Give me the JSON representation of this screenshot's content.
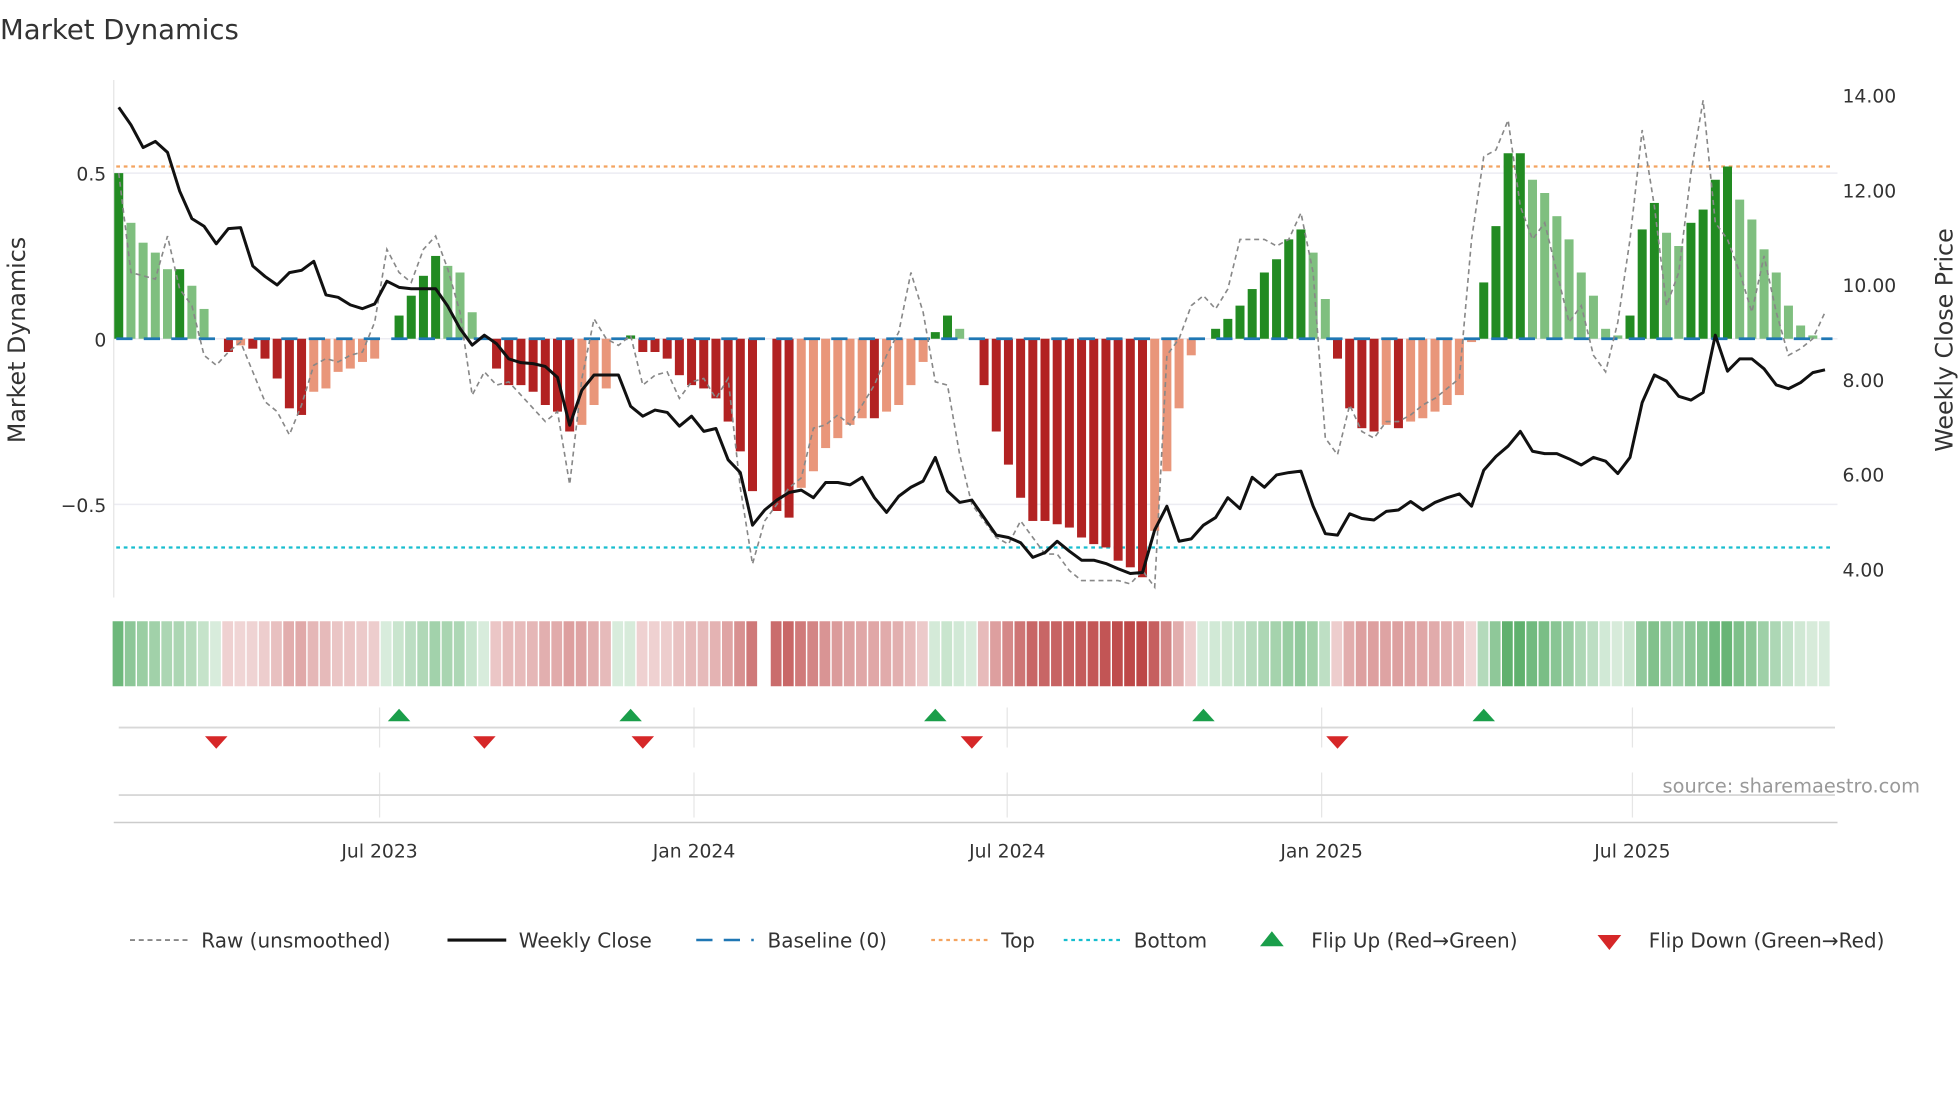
{
  "title": "Market Dynamics",
  "source": "source: sharemaestro.com",
  "legend": {
    "raw": "Raw (unsmoothed)",
    "close": "Weekly Close",
    "baseline": "Baseline (0)",
    "top": "Top",
    "bottom": "Bottom",
    "flip_up": "Flip Up (Red→Green)",
    "flip_down": "Flip Down (Green→Red)"
  },
  "colors": {
    "pos_strong": "#228b22",
    "pos_weak": "#7fbf7f",
    "neg_strong": "#b22222",
    "neg_weak": "#e9967a",
    "baseline": "#1f77b4",
    "top": "#f4a460",
    "bottom": "#17becf",
    "flip_up": "#1a9e4a",
    "flip_down": "#d62728",
    "close": "#111111",
    "raw": "#888888"
  },
  "chart_data": {
    "type": "bar",
    "title": "Market Dynamics",
    "ylabel": "Market Dynamics",
    "y2label": "Weekly Close Price",
    "ylim": [
      -0.78,
      0.78
    ],
    "y2lim": [
      3.0,
      14.5
    ],
    "yticks": [
      {
        "v": 0.5,
        "label": "0.5"
      },
      {
        "v": 0,
        "label": "0"
      },
      {
        "v": -0.5,
        "label": "−0.5"
      }
    ],
    "y2ticks": [
      {
        "v": 14,
        "label": "14.00"
      },
      {
        "v": 12,
        "label": "12.00"
      },
      {
        "v": 10,
        "label": "10.00"
      },
      {
        "v": 8,
        "label": "8.00"
      },
      {
        "v": 6,
        "label": "6.00"
      },
      {
        "v": 4,
        "label": "4.00"
      }
    ],
    "xticks": [
      {
        "week": 21.4,
        "label": "Jul 2023"
      },
      {
        "week": 47.2,
        "label": "Jan 2024"
      },
      {
        "week": 72.9,
        "label": "Jul 2024"
      },
      {
        "week": 98.7,
        "label": "Jan 2025"
      },
      {
        "week": 124.2,
        "label": "Jul 2025"
      }
    ],
    "top_level": 0.52,
    "bottom_level": -0.63,
    "momentum": [
      0.5,
      0.35,
      0.29,
      0.26,
      0.21,
      0.21,
      0.16,
      0.09,
      0,
      -0.04,
      -0.02,
      -0.03,
      -0.06,
      -0.12,
      -0.21,
      -0.23,
      -0.16,
      -0.15,
      -0.1,
      -0.09,
      -0.07,
      -0.06,
      0,
      0.07,
      0.13,
      0.19,
      0.25,
      0.22,
      0.2,
      0.08,
      0,
      -0.09,
      -0.14,
      -0.14,
      -0.16,
      -0.2,
      -0.22,
      -0.28,
      -0.26,
      -0.2,
      -0.15,
      0,
      0.01,
      -0.04,
      -0.04,
      -0.06,
      -0.11,
      -0.14,
      -0.15,
      -0.18,
      -0.25,
      -0.34,
      -0.46,
      0,
      -0.52,
      -0.54,
      -0.45,
      -0.4,
      -0.33,
      -0.3,
      -0.26,
      -0.24,
      -0.24,
      -0.22,
      -0.2,
      -0.14,
      -0.07,
      0.02,
      0.07,
      0.03,
      0,
      -0.14,
      -0.28,
      -0.38,
      -0.48,
      -0.55,
      -0.55,
      -0.56,
      -0.57,
      -0.6,
      -0.62,
      -0.63,
      -0.67,
      -0.69,
      -0.72,
      -0.58,
      -0.4,
      -0.21,
      -0.05,
      0,
      0.03,
      0.06,
      0.1,
      0.15,
      0.2,
      0.24,
      0.3,
      0.33,
      0.26,
      0.12,
      -0.06,
      -0.21,
      -0.27,
      -0.28,
      -0.26,
      -0.27,
      -0.25,
      -0.24,
      -0.22,
      -0.2,
      -0.17,
      -0.01,
      0.17,
      0.34,
      0.56,
      0.56,
      0.48,
      0.44,
      0.37,
      0.3,
      0.2,
      0.13,
      0.03,
      0.01,
      0.07,
      0.33,
      0.41,
      0.32,
      0.28,
      0.35,
      0.39,
      0.48,
      0.52,
      0.42,
      0.36,
      0.27,
      0.2,
      0.1,
      0.04,
      0.01,
      0.0
    ],
    "raw": [
      0.5,
      0.2,
      0.19,
      0.18,
      0.31,
      0.15,
      0.1,
      -0.05,
      -0.08,
      -0.04,
      -0.01,
      -0.1,
      -0.19,
      -0.22,
      -0.29,
      -0.2,
      -0.08,
      -0.06,
      -0.07,
      -0.05,
      -0.04,
      0.05,
      0.27,
      0.2,
      0.17,
      0.27,
      0.31,
      0.21,
      0.08,
      -0.17,
      -0.1,
      -0.14,
      -0.13,
      -0.17,
      -0.21,
      -0.25,
      -0.22,
      -0.44,
      -0.12,
      0.06,
      0.0,
      -0.02,
      0.01,
      -0.14,
      -0.11,
      -0.1,
      -0.18,
      -0.13,
      -0.12,
      -0.18,
      -0.12,
      -0.45,
      -0.68,
      -0.55,
      -0.5,
      -0.45,
      -0.42,
      -0.27,
      -0.26,
      -0.23,
      -0.26,
      -0.2,
      -0.14,
      -0.05,
      0.02,
      0.2,
      0.08,
      -0.13,
      -0.14,
      -0.35,
      -0.5,
      -0.55,
      -0.6,
      -0.62,
      -0.55,
      -0.6,
      -0.65,
      -0.65,
      -0.7,
      -0.73,
      -0.73,
      -0.73,
      -0.73,
      -0.74,
      -0.7,
      -0.75,
      -0.05,
      0.0,
      0.1,
      0.13,
      0.09,
      0.15,
      0.3,
      0.3,
      0.3,
      0.28,
      0.3,
      0.38,
      0.2,
      -0.3,
      -0.35,
      -0.2,
      -0.28,
      -0.3,
      -0.25,
      -0.25,
      -0.23,
      -0.2,
      -0.18,
      -0.15,
      -0.12,
      0.3,
      0.55,
      0.57,
      0.66,
      0.4,
      0.3,
      0.35,
      0.2,
      0.05,
      0.1,
      -0.05,
      -0.1,
      0.05,
      0.3,
      0.63,
      0.4,
      0.1,
      0.2,
      0.5,
      0.72,
      0.35,
      0.3,
      0.2,
      0.08,
      0.25,
      0.08,
      -0.05,
      -0.03,
      0.0,
      0.08
    ],
    "close": [
      13.74,
      13.37,
      12.89,
      13.02,
      12.79,
      11.97,
      11.39,
      11.23,
      10.86,
      11.18,
      11.2,
      10.39,
      10.17,
      9.99,
      10.25,
      10.3,
      10.49,
      9.78,
      9.73,
      9.57,
      9.49,
      9.59,
      10.07,
      9.94,
      9.91,
      9.91,
      9.91,
      9.54,
      9.07,
      8.72,
      8.93,
      8.75,
      8.43,
      8.35,
      8.33,
      8.27,
      8.04,
      7.03,
      7.77,
      8.09,
      8.09,
      8.09,
      7.43,
      7.22,
      7.35,
      7.3,
      7.01,
      7.22,
      6.9,
      6.96,
      6.3,
      6.03,
      4.92,
      5.24,
      5.45,
      5.61,
      5.66,
      5.5,
      5.82,
      5.82,
      5.77,
      5.93,
      5.5,
      5.19,
      5.53,
      5.72,
      5.85,
      6.35,
      5.64,
      5.4,
      5.45,
      5.08,
      4.71,
      4.66,
      4.55,
      4.24,
      4.34,
      4.58,
      4.37,
      4.18,
      4.18,
      4.11,
      4.0,
      3.9,
      3.92,
      4.82,
      5.32,
      4.58,
      4.63,
      4.92,
      5.08,
      5.5,
      5.27,
      5.93,
      5.72,
      5.98,
      6.03,
      6.06,
      5.32,
      4.74,
      4.71,
      5.16,
      5.06,
      5.03,
      5.21,
      5.24,
      5.42,
      5.24,
      5.4,
      5.5,
      5.58,
      5.32,
      6.08,
      6.37,
      6.59,
      6.9,
      6.48,
      6.43,
      6.43,
      6.32,
      6.19,
      6.35,
      6.27,
      6.01,
      6.35,
      7.51,
      8.09,
      7.96,
      7.64,
      7.56,
      7.72,
      8.93,
      8.17,
      8.43,
      8.43,
      8.22,
      7.88,
      7.8,
      7.93,
      8.14,
      8.2
    ],
    "missing_weeks": [
      53
    ],
    "flip_up_weeks": [
      23,
      42,
      67,
      89,
      112
    ],
    "flip_down_weeks": [
      8,
      30,
      43,
      70,
      100
    ]
  }
}
